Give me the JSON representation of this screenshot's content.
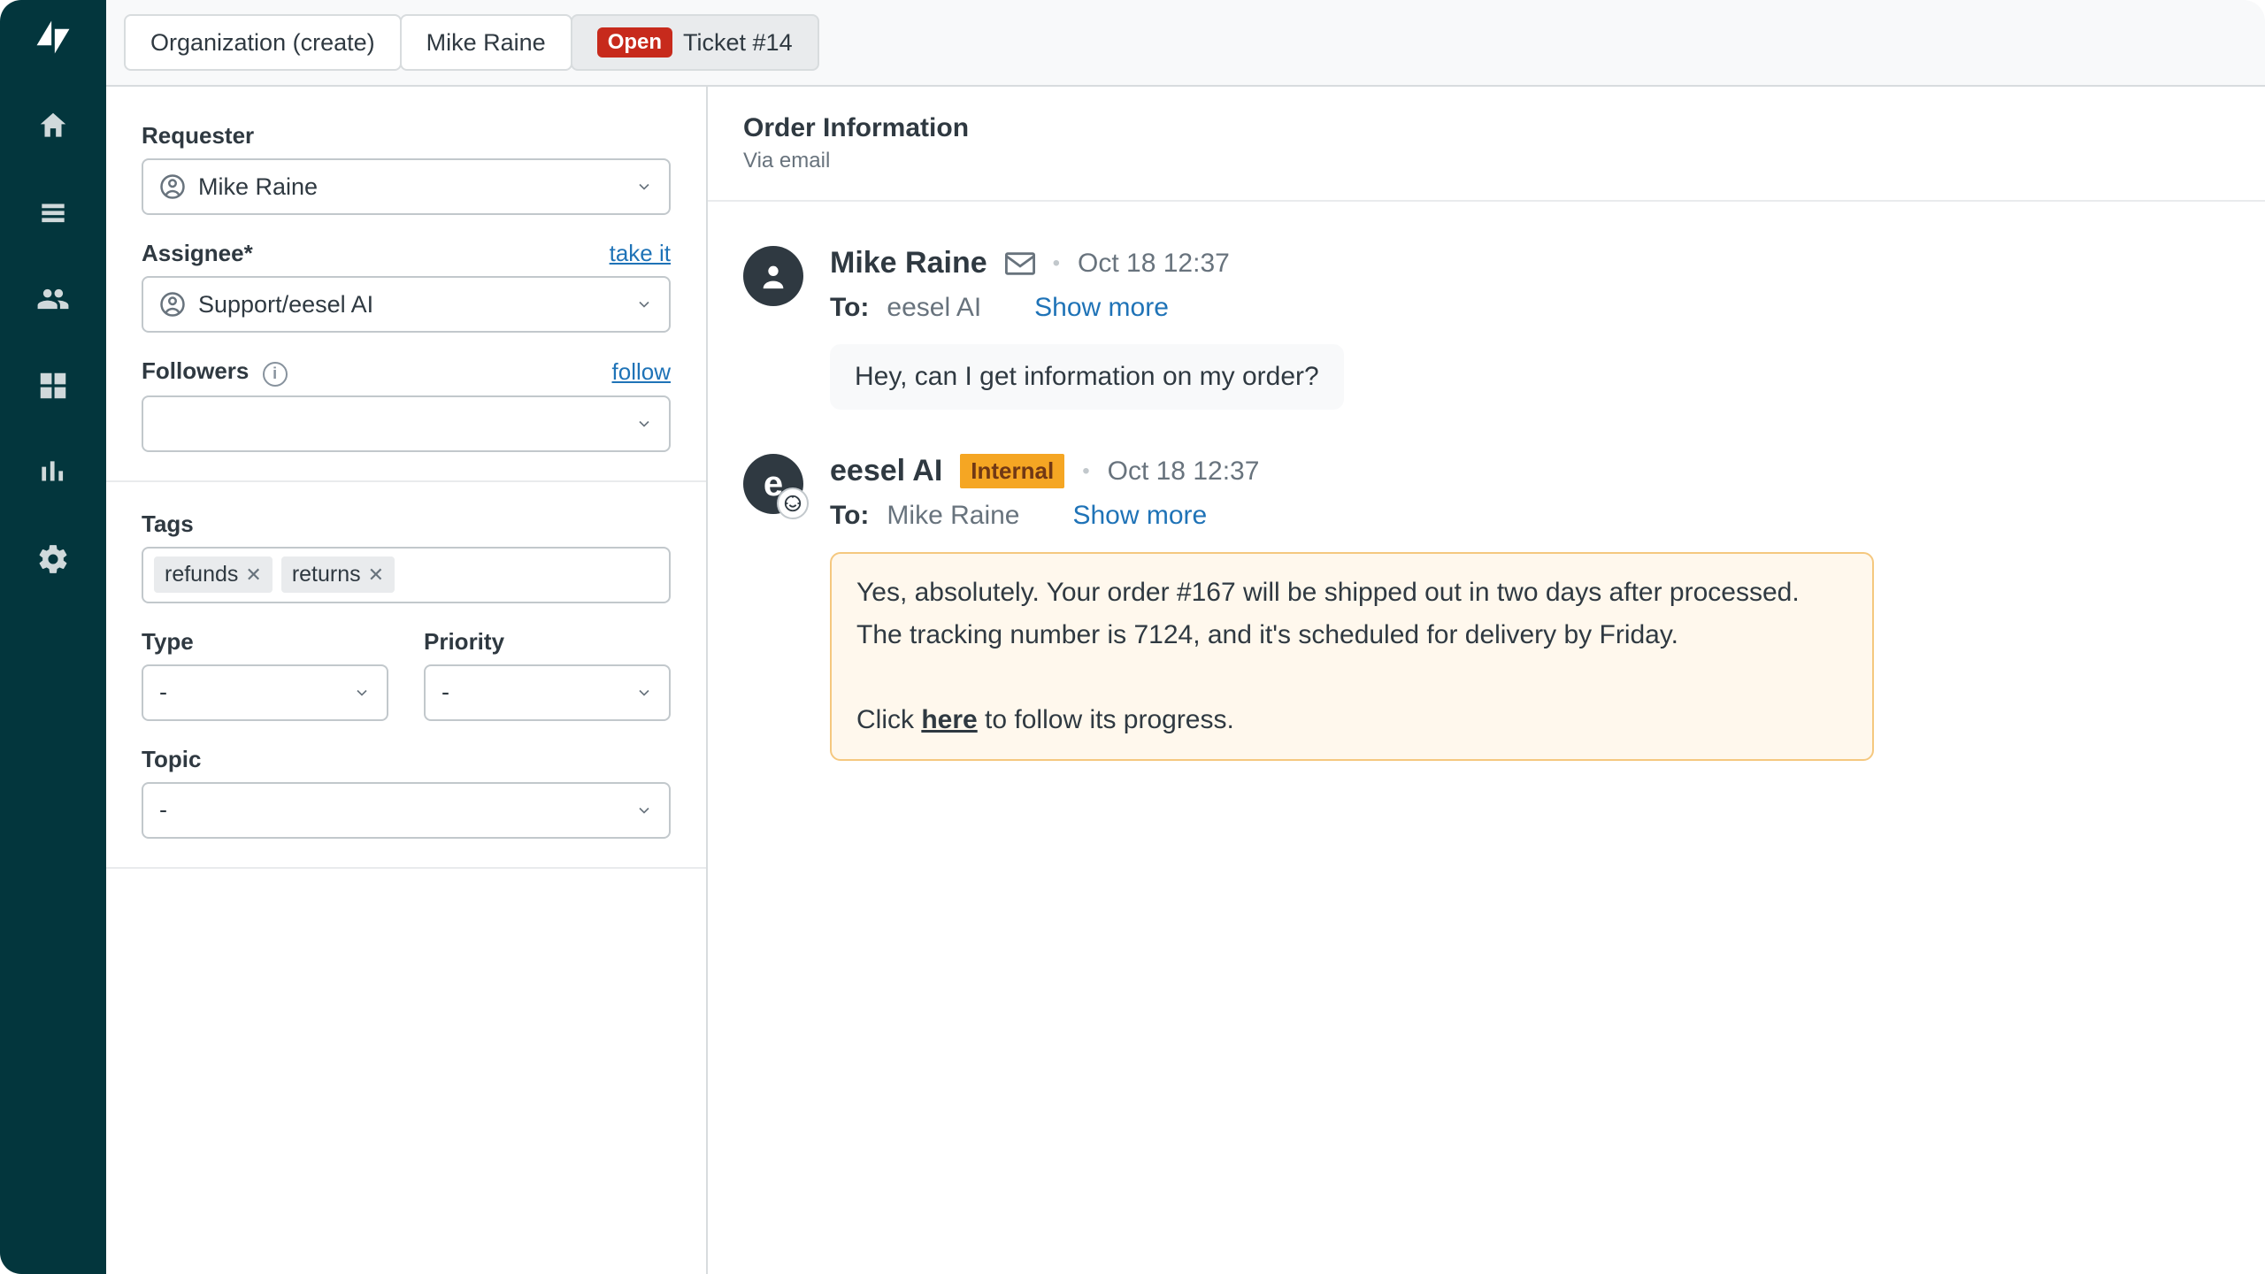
{
  "tabs": [
    {
      "label": "Organization (create)",
      "active": false
    },
    {
      "label": "Mike Raine",
      "active": false
    },
    {
      "badge": "Open",
      "label": "Ticket #14",
      "active": true
    }
  ],
  "sidebar": {
    "requester": {
      "label": "Requester",
      "value": "Mike Raine"
    },
    "assignee": {
      "label": "Assignee*",
      "link": "take it",
      "value": "Support/eesel AI"
    },
    "followers": {
      "label": "Followers",
      "link": "follow",
      "value": ""
    },
    "tags": {
      "label": "Tags",
      "items": [
        "refunds",
        "returns"
      ]
    },
    "type": {
      "label": "Type",
      "value": "-"
    },
    "priority": {
      "label": "Priority",
      "value": "-"
    },
    "topic": {
      "label": "Topic",
      "value": "-"
    }
  },
  "content": {
    "title": "Order Information",
    "via": "Via email",
    "messages": [
      {
        "author": "Mike Raine",
        "timestamp": "Oct 18 12:37",
        "to_label": "To:",
        "to_value": "eesel AI",
        "showmore": "Show more",
        "body": "Hey, can I get information on my order?",
        "internal": false
      },
      {
        "author": "eesel AI",
        "internal_badge": "Internal",
        "timestamp": "Oct 18 12:37",
        "to_label": "To:",
        "to_value": "Mike Raine",
        "showmore": "Show more",
        "body_p1": "Yes, absolutely. Your order #167 will be shipped out in two days after processed. The tracking number is 7124, and it's scheduled for delivery by Friday.",
        "body_p2_pre": "Click ",
        "body_p2_link": "here",
        "body_p2_post": " to follow its progress.",
        "internal": true
      }
    ]
  }
}
